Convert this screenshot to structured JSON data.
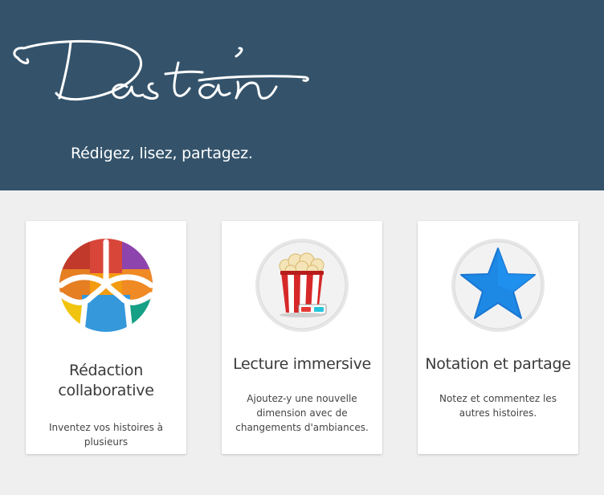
{
  "header": {
    "logo_text": "Dastan",
    "tagline": "Rédigez, lisez, partagez.",
    "background_color": "#34536b"
  },
  "features": [
    {
      "icon": "collaboration-icon",
      "title_line1": "Rédaction",
      "title_line2": "collaborative",
      "description": "Inventez vos histoires à plusieurs"
    },
    {
      "icon": "popcorn-icon",
      "title": "Lecture immersive",
      "description": "Ajoutez-y une nouvelle dimension avec de changements d'ambiances."
    },
    {
      "icon": "star-icon",
      "title": "Notation et partage",
      "description": "Notez et commentez les autres histoires."
    }
  ]
}
